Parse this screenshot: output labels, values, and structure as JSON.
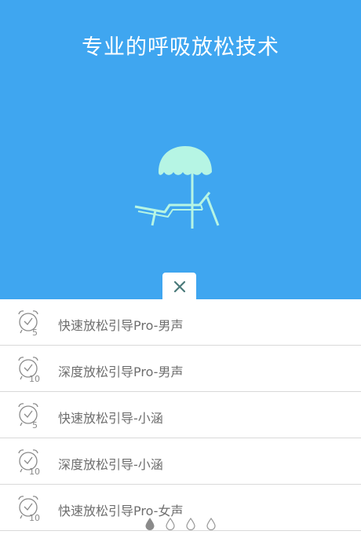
{
  "hero": {
    "title": "专业的呼吸放松技术",
    "illustration": "beach-umbrella-lounge-chair-icon",
    "background_color": "#3fa6f0",
    "umbrella_color": "#b6f5e4"
  },
  "close_button": {
    "icon": "close-icon",
    "color": "#4a7a7a"
  },
  "list": {
    "items": [
      {
        "label": "快速放松引导Pro-男声",
        "minutes": "5",
        "icon": "alarm-clock-icon"
      },
      {
        "label": "深度放松引导Pro-男声",
        "minutes": "10",
        "icon": "alarm-clock-icon"
      },
      {
        "label": "快速放松引导-小涵",
        "minutes": "5",
        "icon": "alarm-clock-icon"
      },
      {
        "label": "深度放松引导-小涵",
        "minutes": "10",
        "icon": "alarm-clock-icon"
      },
      {
        "label": "快速放松引导Pro-女声",
        "minutes": "10",
        "icon": "alarm-clock-icon"
      }
    ]
  },
  "pager": {
    "count": 4,
    "active_index": 0,
    "icon": "water-drop-icon"
  }
}
